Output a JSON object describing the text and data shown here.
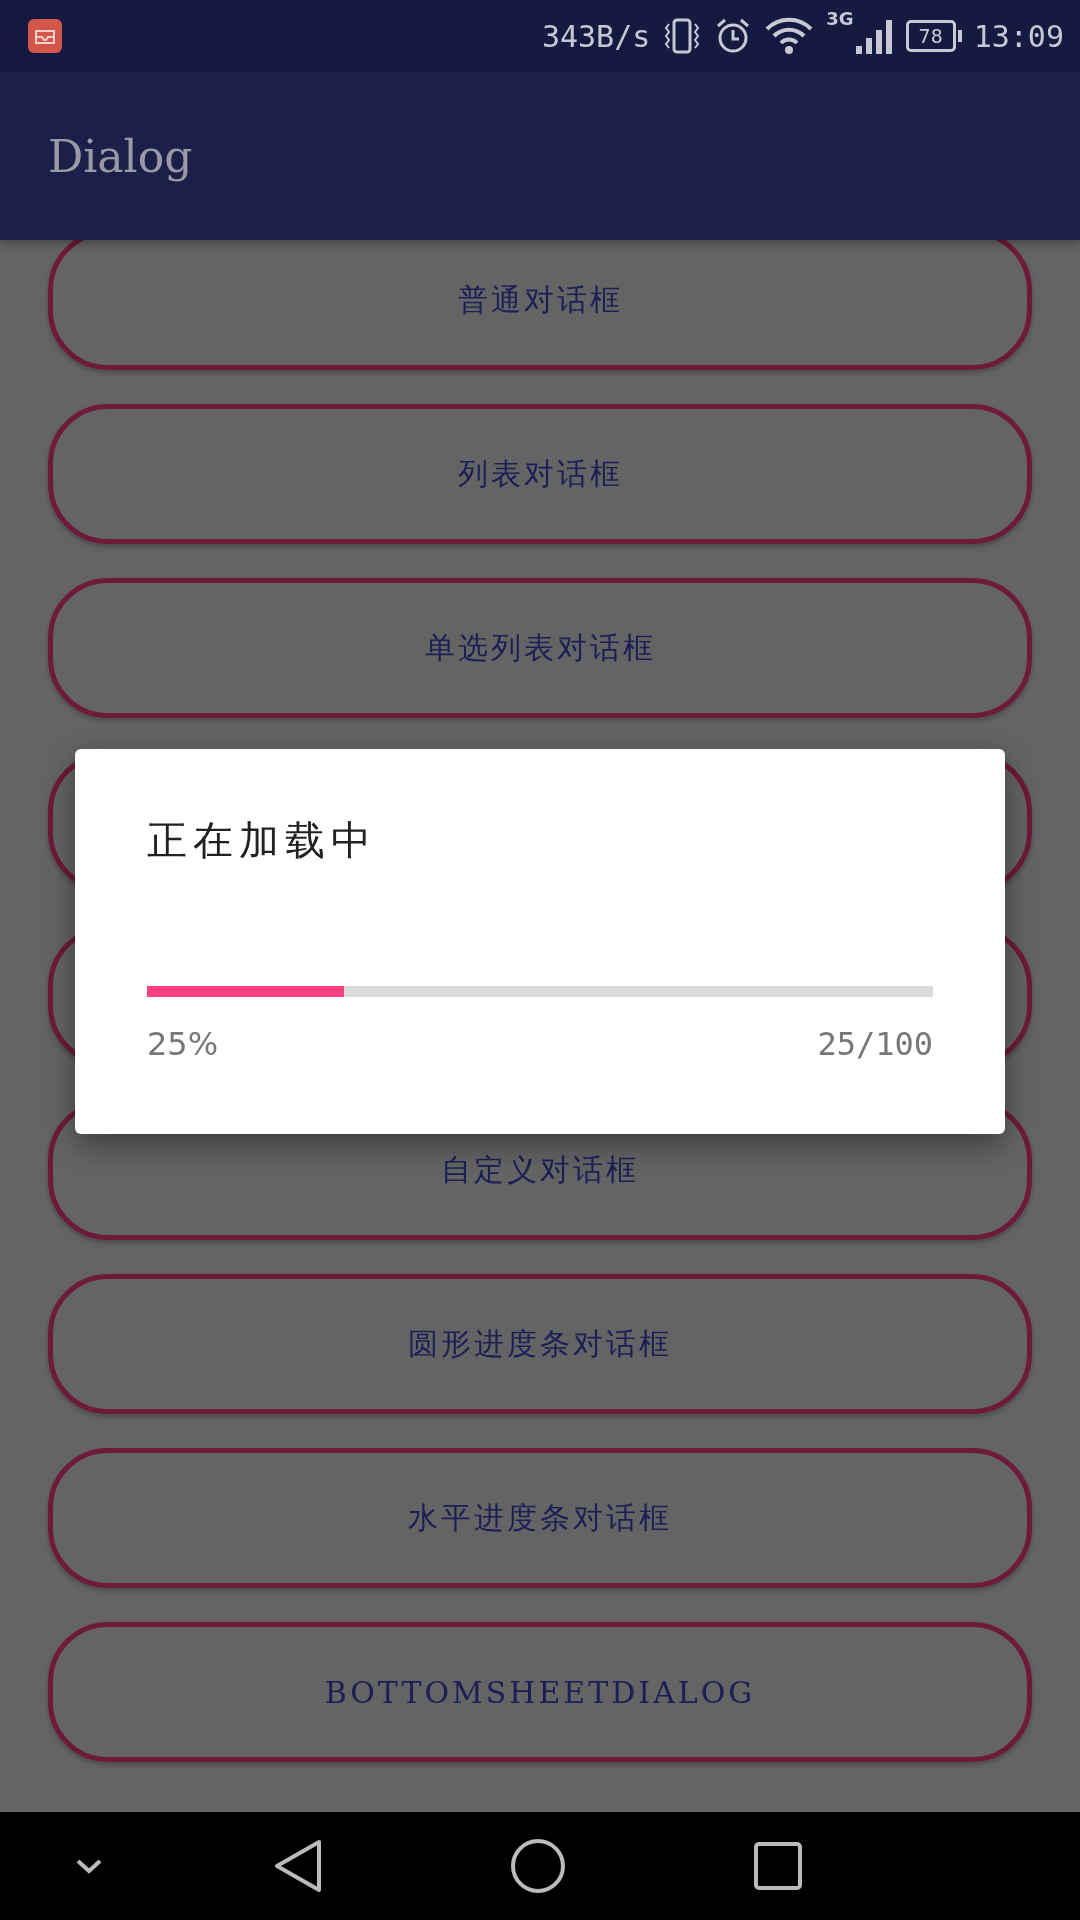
{
  "status_bar": {
    "net_speed": "343B/s",
    "network_type": "3G",
    "battery": "78",
    "time": "13:09"
  },
  "app_bar": {
    "title": "Dialog"
  },
  "buttons": [
    {
      "kind": "labeled",
      "label": "普通对话框"
    },
    {
      "kind": "labeled",
      "label": "列表对话框"
    },
    {
      "kind": "labeled",
      "label": "单选列表对话框"
    },
    {
      "kind": "covered"
    },
    {
      "kind": "covered"
    },
    {
      "kind": "labeled",
      "label": "自定义对话框"
    },
    {
      "kind": "labeled",
      "label": "圆形进度条对话框"
    },
    {
      "kind": "labeled",
      "label": "水平进度条对话框"
    },
    {
      "kind": "labeled",
      "label": "BOTTOMSHEETDIALOG"
    }
  ],
  "dialog": {
    "title": "正在加载中",
    "level": 0.25,
    "percent": "25%",
    "count": "25/100"
  }
}
